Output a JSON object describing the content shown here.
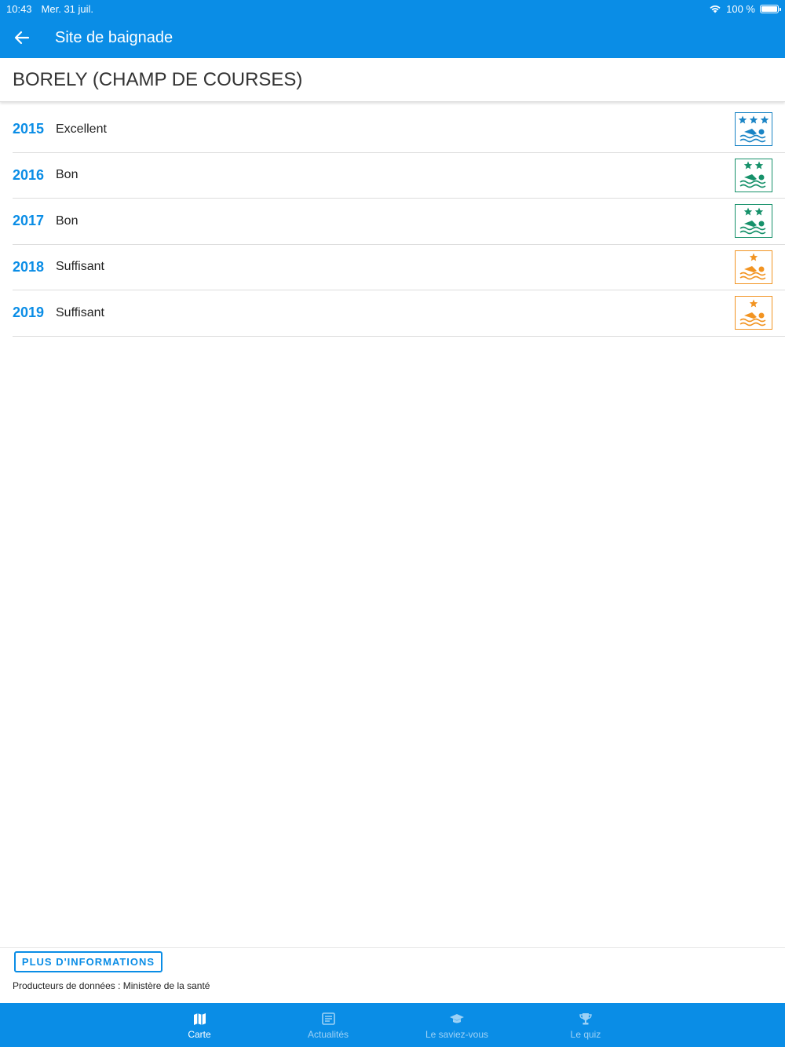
{
  "status_bar": {
    "time": "10:43",
    "date": "Mer. 31 juil.",
    "battery": "100 %"
  },
  "app_bar": {
    "title": "Site de baignade"
  },
  "site": {
    "name": "BORELY (CHAMP DE COURSES)"
  },
  "quality_rows": [
    {
      "year": "2015",
      "label": "Excellent",
      "stars": 3,
      "color": "#1a84c5"
    },
    {
      "year": "2016",
      "label": "Bon",
      "stars": 2,
      "color": "#16916a"
    },
    {
      "year": "2017",
      "label": "Bon",
      "stars": 2,
      "color": "#16916a"
    },
    {
      "year": "2018",
      "label": "Suffisant",
      "stars": 1,
      "color": "#f29422"
    },
    {
      "year": "2019",
      "label": "Suffisant",
      "stars": 1,
      "color": "#f29422"
    }
  ],
  "footer": {
    "more_button": "PLUS D'INFORMATIONS",
    "producers": "Producteurs de données : Ministère de la santé"
  },
  "tabs": [
    {
      "label": "Carte",
      "icon": "map-icon",
      "active": true
    },
    {
      "label": "Actualités",
      "icon": "newspaper-icon",
      "active": false
    },
    {
      "label": "Le saviez-vous",
      "icon": "graduation-cap-icon",
      "active": false
    },
    {
      "label": "Le quiz",
      "icon": "trophy-icon",
      "active": false
    }
  ],
  "colors": {
    "primary": "#0a8de6"
  }
}
